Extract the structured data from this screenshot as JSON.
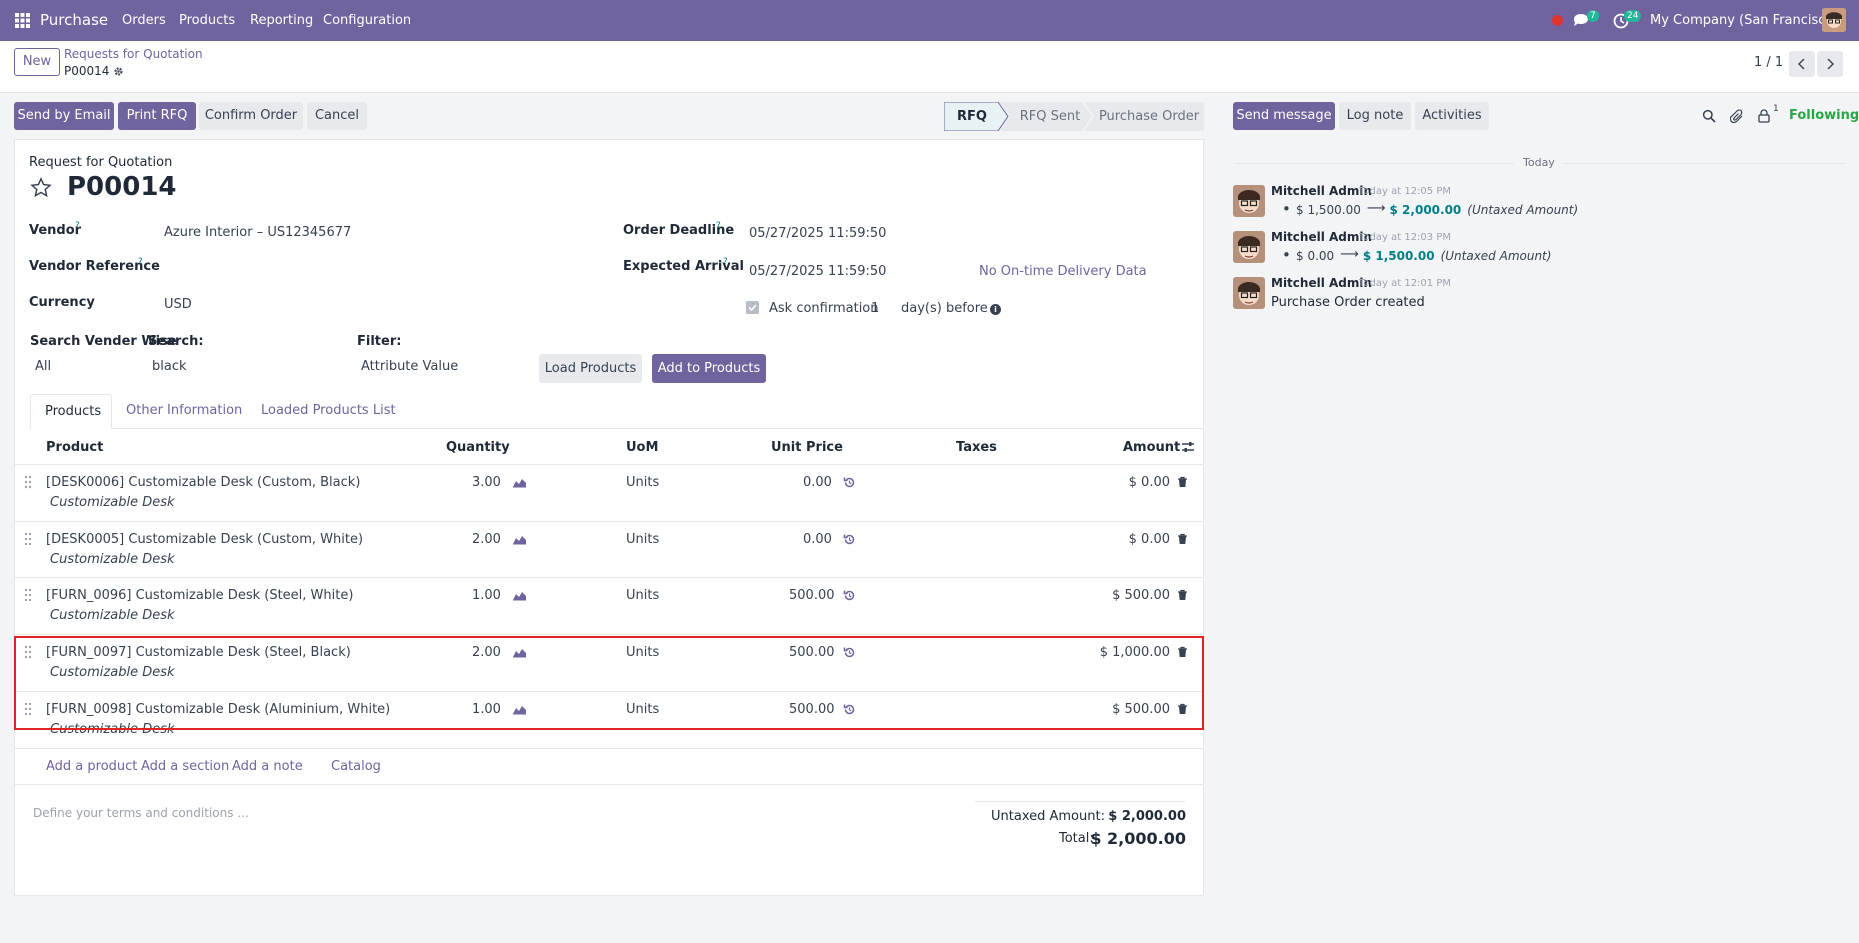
{
  "navbar": {
    "app_name": "Purchase",
    "menu": [
      "Orders",
      "Products",
      "Reporting",
      "Configuration"
    ],
    "messages_count": "7",
    "activities_count": "24",
    "company": "My Company (San Francisco)"
  },
  "breadcrumb": {
    "new_label": "New",
    "parent": "Requests for Quotation",
    "current": "P00014",
    "pager": "1 / 1"
  },
  "actions": {
    "send_by_email": "Send by Email",
    "print_rfq": "Print RFQ",
    "confirm_order": "Confirm Order",
    "cancel": "Cancel"
  },
  "statusbar": [
    "RFQ",
    "RFQ Sent",
    "Purchase Order"
  ],
  "form": {
    "doc_type": "Request for Quotation",
    "doc_name": "P00014",
    "vendor_label": "Vendor",
    "vendor_value": "Azure Interior – US12345677",
    "vendor_ref_label": "Vendor Reference",
    "currency_label": "Currency",
    "currency_value": "USD",
    "order_deadline_label": "Order Deadline",
    "order_deadline_value": "05/27/2025 11:59:50",
    "expected_arrival_label": "Expected Arrival",
    "expected_arrival_value": "05/27/2025 11:59:50",
    "on_time_label": "No On-time Delivery Data",
    "ask_confirmation_label": "Ask confirmation",
    "ask_confirmation_days": "1",
    "days_before_label": "day(s) before",
    "search_vendor_label": "Search Vender Wise",
    "search_vendor_value": "All",
    "search_label": "Search:",
    "search_value": "black",
    "filter_label": "Filter:",
    "filter_value": "Attribute Value",
    "load_products": "Load Products",
    "add_to_products": "Add to Products"
  },
  "tabs": [
    "Products",
    "Other Information",
    "Loaded Products List"
  ],
  "table": {
    "headers": {
      "product": "Product",
      "quantity": "Quantity",
      "uom": "UoM",
      "unit_price": "Unit Price",
      "taxes": "Taxes",
      "amount": "Amount"
    },
    "rows": [
      {
        "product": "[DESK0006] Customizable Desk (Custom, Black)",
        "description": "Customizable Desk",
        "quantity": "3.00",
        "uom": "Units",
        "unit_price": "0.00",
        "amount": "$ 0.00"
      },
      {
        "product": "[DESK0005] Customizable Desk (Custom, White)",
        "description": "Customizable Desk",
        "quantity": "2.00",
        "uom": "Units",
        "unit_price": "0.00",
        "amount": "$ 0.00"
      },
      {
        "product": "[FURN_0096] Customizable Desk (Steel, White)",
        "description": "Customizable Desk",
        "quantity": "1.00",
        "uom": "Units",
        "unit_price": "500.00",
        "amount": "$ 500.00"
      },
      {
        "product": "[FURN_0097] Customizable Desk (Steel, Black)",
        "description": "Customizable Desk",
        "quantity": "2.00",
        "uom": "Units",
        "unit_price": "500.00",
        "amount": "$ 1,000.00"
      },
      {
        "product": "[FURN_0098] Customizable Desk (Aluminium, White)",
        "description": "Customizable Desk",
        "quantity": "1.00",
        "uom": "Units",
        "unit_price": "500.00",
        "amount": "$ 500.00"
      }
    ],
    "add_product": "Add a product",
    "add_section": "Add a section",
    "add_note": "Add a note",
    "catalog": "Catalog"
  },
  "footer": {
    "terms_placeholder": "Define your terms and conditions ...",
    "untaxed_label": "Untaxed Amount:",
    "untaxed_value": "$ 2,000.00",
    "total_label": "Total:",
    "total_value": "$ 2,000.00"
  },
  "chatter": {
    "send_message": "Send message",
    "log_note": "Log note",
    "activities": "Activities",
    "followers_count": "1",
    "following": "Following",
    "date_separator": "Today",
    "messages": [
      {
        "author": "Mitchell Admin",
        "time": "Today at 12:05 PM",
        "old": "$ 1,500.00",
        "new": "$ 2,000.00",
        "field": "(Untaxed Amount)"
      },
      {
        "author": "Mitchell Admin",
        "time": "Today at 12:03 PM",
        "old": "$ 0.00",
        "new": "$ 1,500.00",
        "field": "(Untaxed Amount)"
      },
      {
        "author": "Mitchell Admin",
        "time": "Today at 12:01 PM",
        "body": "Purchase Order created"
      }
    ]
  },
  "colors": {
    "brand": "#71639e",
    "highlight_border": "#e02424",
    "tracking_new": "#017e84",
    "following": "#28a745"
  }
}
